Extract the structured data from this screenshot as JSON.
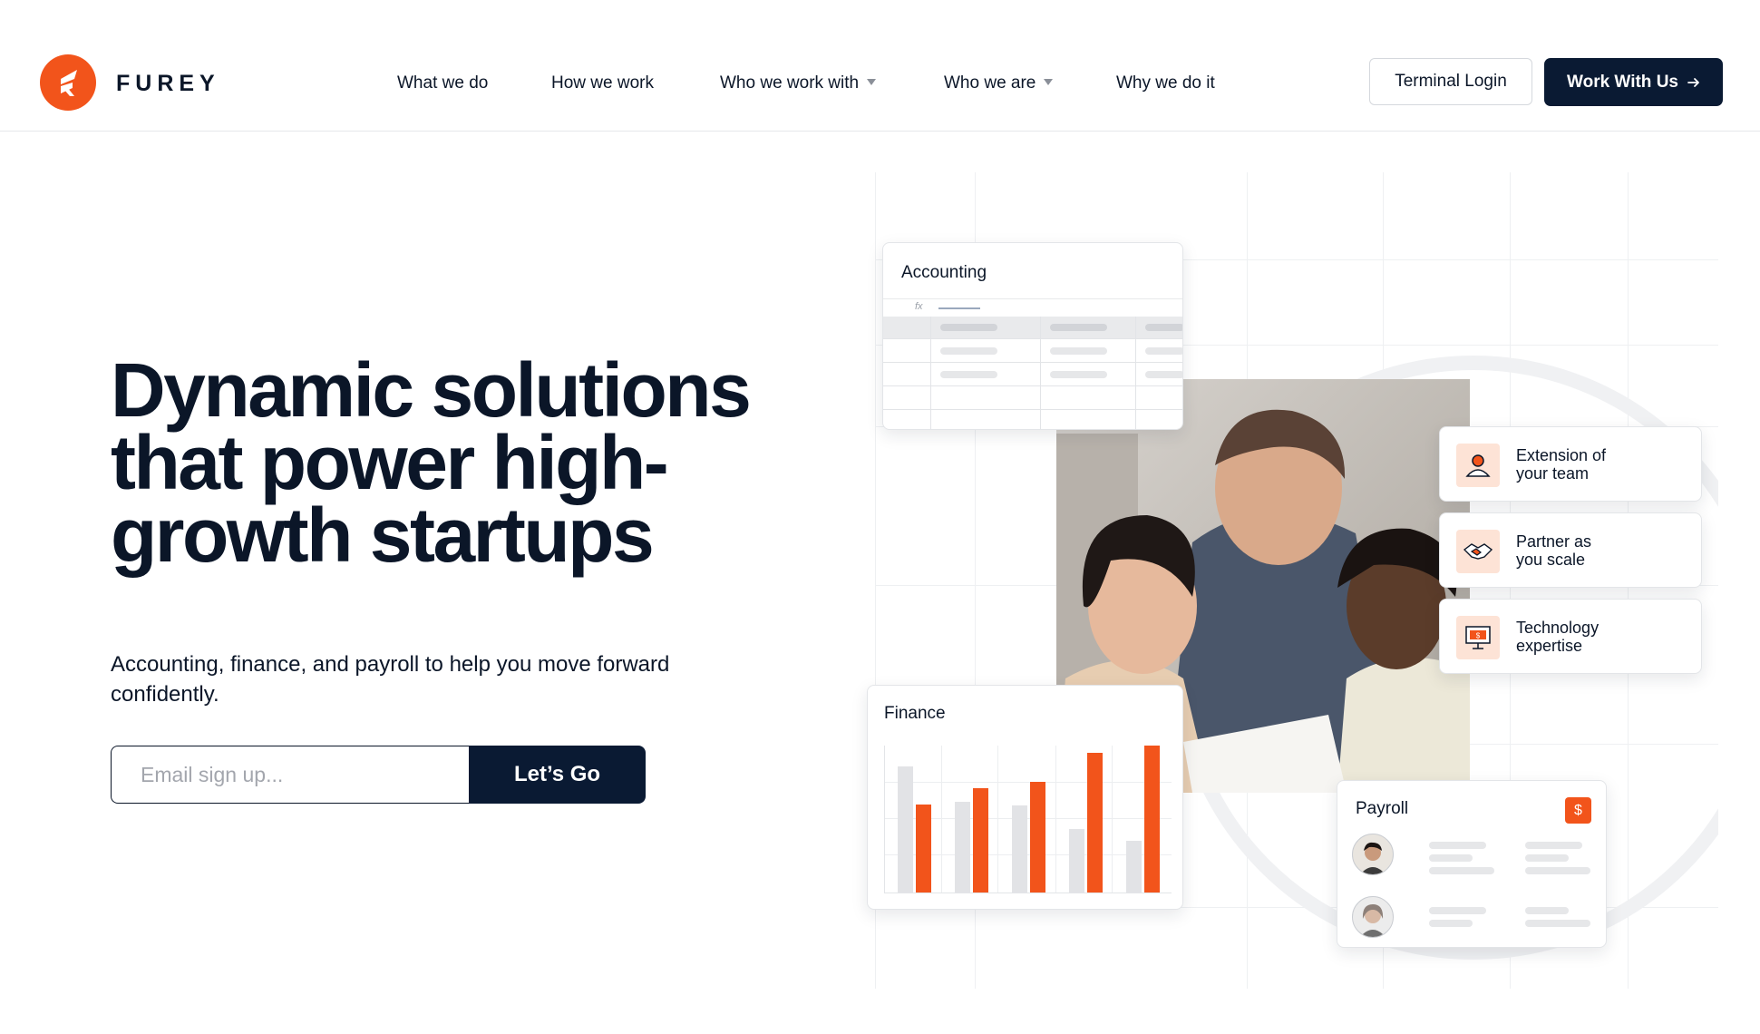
{
  "brand": {
    "name": "FUREY",
    "accent": "#f2541b",
    "dark": "#0a1a33"
  },
  "nav": {
    "items": [
      {
        "label": "What we do",
        "dropdown": false
      },
      {
        "label": "How we work",
        "dropdown": false
      },
      {
        "label": "Who we work with",
        "dropdown": true
      },
      {
        "label": "Who we are",
        "dropdown": true
      },
      {
        "label": "Why we do it",
        "dropdown": false
      }
    ],
    "login_label": "Terminal Login",
    "cta_label": "Work With Us",
    "cta_icon": "arrow-right-icon"
  },
  "hero": {
    "title": "Dynamic solutions that power high-growth startups",
    "subtitle": "Accounting, finance, and payroll to help you move forward confidently.",
    "email_placeholder": "Email sign up...",
    "submit_label": "Let’s Go"
  },
  "illustration": {
    "accounting": {
      "title": "Accounting",
      "formula_icon": "fx"
    },
    "finance": {
      "title": "Finance",
      "bars": [
        {
          "grey": 0.86,
          "orange": 0.6
        },
        {
          "grey": 0.62,
          "orange": 0.71
        },
        {
          "grey": 0.59,
          "orange": 0.75
        },
        {
          "grey": 0.43,
          "orange": 0.95
        },
        {
          "grey": 0.35,
          "orange": 1.0
        }
      ]
    },
    "features": [
      {
        "line1": "Extension of",
        "line2": "your team",
        "icon": "person-icon"
      },
      {
        "line1": "Partner as",
        "line2": "you scale",
        "icon": "handshake-icon"
      },
      {
        "line1": "Technology",
        "line2": "expertise",
        "icon": "monitor-dollar-icon"
      }
    ],
    "payroll": {
      "title": "Payroll",
      "badge": "$"
    }
  }
}
